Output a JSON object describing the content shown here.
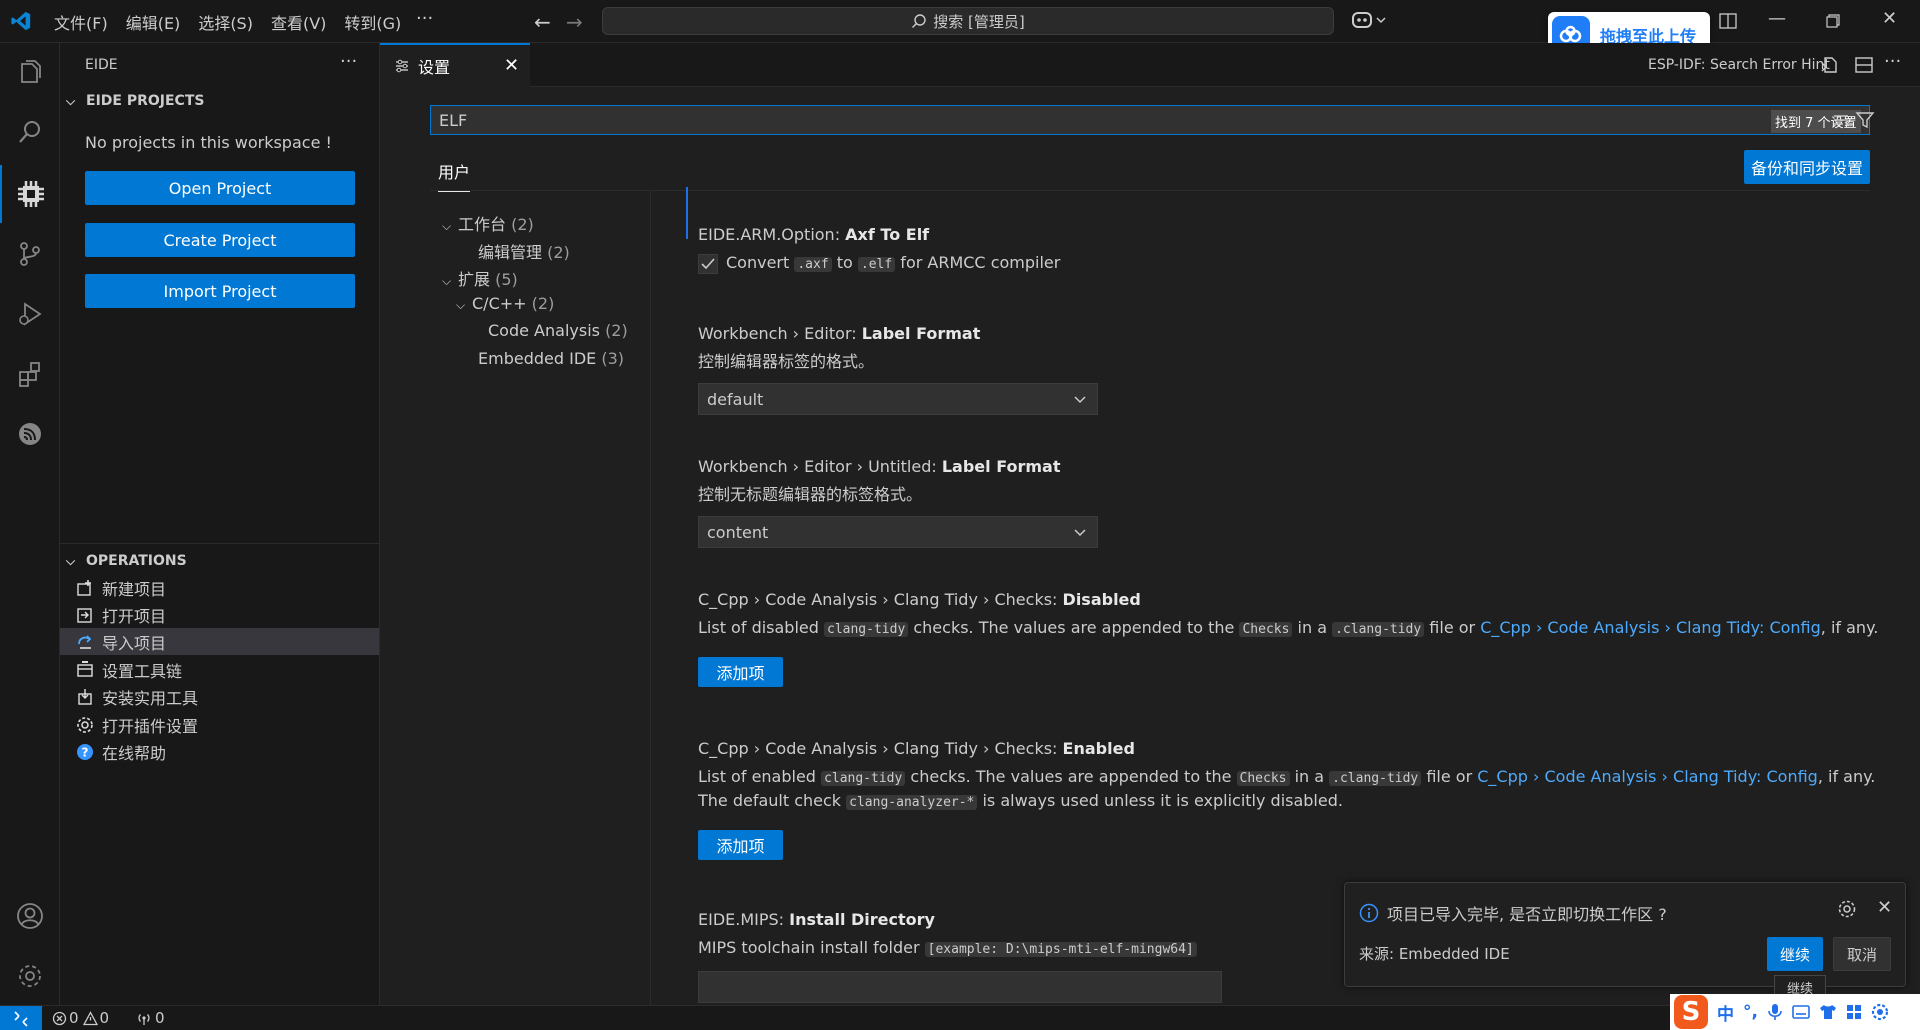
{
  "titlebar": {
    "menu": [
      "文件(F)",
      "编辑(E)",
      "选择(S)",
      "查看(V)",
      "转到(G)"
    ],
    "more": "···",
    "search": "搜索 [管理员]",
    "upload_widget": "拖拽至此上传"
  },
  "sidebar": {
    "title": "EIDE",
    "projects_header": "EIDE PROJECTS",
    "no_projects": "No projects in this workspace !",
    "buttons": [
      "Open Project",
      "Create Project",
      "Import Project"
    ],
    "operations_header": "OPERATIONS",
    "operations": [
      "新建项目",
      "打开项目",
      "导入项目",
      "设置工具链",
      "安装实用工具",
      "打开插件设置",
      "在线帮助"
    ]
  },
  "tabbar": {
    "tab_label": "设置",
    "right_text": "ESP-IDF: Search Error Hint"
  },
  "settings": {
    "search_value": "ELF",
    "search_count": "找到 7 个设置",
    "scope_tab": "用户",
    "backup_button": "备份和同步设置",
    "toc": [
      {
        "label": "工作台",
        "count": "(2)"
      },
      {
        "label": "编辑管理",
        "count": "(2)"
      },
      {
        "label": "扩展",
        "count": "(5)"
      },
      {
        "label": "C/C++",
        "count": "(2)"
      },
      {
        "label": "Code Analysis",
        "count": "(2)"
      },
      {
        "label": "Embedded IDE",
        "count": "(3)"
      }
    ],
    "items": [
      {
        "prefix": "EIDE.ARM.Option: ",
        "name": "Axf To Elf",
        "desc_a": "Convert ",
        "code1": ".axf",
        "desc_b": " to ",
        "code2": ".elf",
        "desc_c": " for ARMCC compiler",
        "checked": true
      },
      {
        "prefix": "Workbench › Editor: ",
        "name": "Label Format",
        "desc": "控制编辑器标签的格式。",
        "value": "default"
      },
      {
        "prefix": "Workbench › Editor › Untitled: ",
        "name": "Label Format",
        "desc": "控制无标题编辑器的标签格式。",
        "value": "content"
      },
      {
        "prefix": "C_Cpp › Code Analysis › Clang Tidy › Checks: ",
        "name": "Disabled",
        "d1": "List of disabled ",
        "c1": "clang-tidy",
        "d2": " checks. The values are appended to the ",
        "c2": "Checks",
        "d3": " in a ",
        "c3": ".clang-tidy",
        "d4": " file or ",
        "link": "C_Cpp › Code Analysis › Clang Tidy: Config",
        "d5": ", if any.",
        "button": "添加项"
      },
      {
        "prefix": "C_Cpp › Code Analysis › Clang Tidy › Checks: ",
        "name": "Enabled",
        "d1": "List of enabled ",
        "c1": "clang-tidy",
        "d2": " checks. The values are appended to the ",
        "c2": "Checks",
        "d3": " in a ",
        "c3": ".clang-tidy",
        "d4": " file or ",
        "link": "C_Cpp › Code Analysis › Clang Tidy: Config",
        "d5": ", if any. The default check ",
        "c4": "clang-analyzer-*",
        "d6": " is always used unless it is explicitly disabled.",
        "button": "添加项"
      },
      {
        "prefix": "EIDE.MIPS: ",
        "name": "Install Directory",
        "desc": "MIPS toolchain install folder ",
        "code": "[example: D:\\mips-mti-elf-mingw64]"
      }
    ]
  },
  "notification": {
    "message": "项目已导入完毕, 是否立即切换工作区 ?",
    "source": "来源: Embedded IDE",
    "primary": "继续",
    "secondary": "取消",
    "tooltip": "继续"
  },
  "statusbar": {
    "errors": "0",
    "warnings": "0",
    "ports": "0"
  },
  "ime": {
    "lang": "中"
  },
  "colors": {
    "accent": "#0078d4",
    "link": "#4daafc",
    "background": "#1f1f1f"
  }
}
